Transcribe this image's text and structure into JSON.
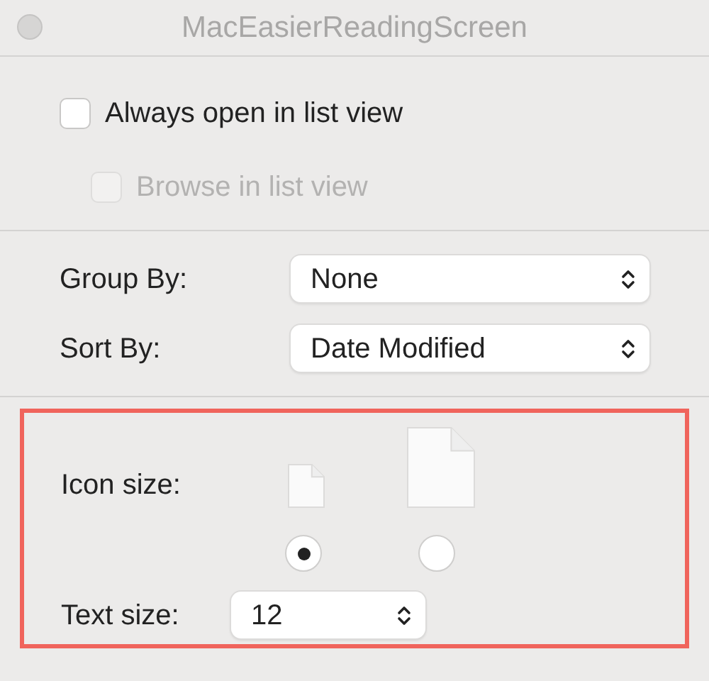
{
  "window": {
    "title": "MacEasierReadingScreen"
  },
  "checkboxes": [
    {
      "label": "Always open in list view",
      "checked": false,
      "disabled": false
    },
    {
      "label": "Browse in list view",
      "checked": false,
      "disabled": true
    }
  ],
  "popups": [
    {
      "label": "Group By:",
      "value": "None"
    },
    {
      "label": "Sort By:",
      "value": "Date Modified"
    }
  ],
  "icon_section": {
    "highlighted": true,
    "label": "Icon size:",
    "options": [
      {
        "kind": "small",
        "selected": true
      },
      {
        "kind": "large",
        "selected": false
      }
    ],
    "text_size": {
      "label": "Text size:",
      "value": "12"
    }
  }
}
